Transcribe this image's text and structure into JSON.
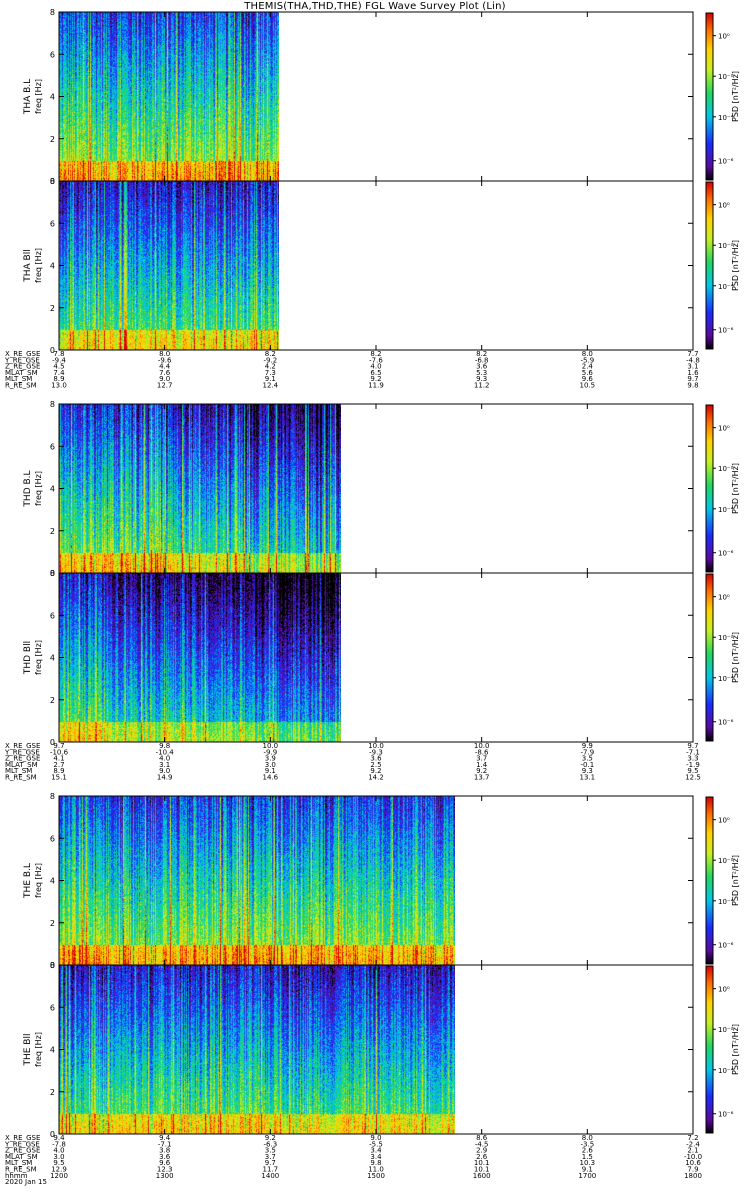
{
  "title": "THEMIS(THA,THD,THE) FGL Wave Survey Plot (Lin)",
  "colors": {
    "background": "#ffffff",
    "axes": "#000000"
  },
  "chart_data": {
    "type": "heatmap",
    "colormap": "rainbow (black-purple-blue-cyan-green-yellow-orange-red)",
    "x_axis": {
      "label": "hhmm",
      "ticks": [
        "1200",
        "1300",
        "1400",
        "1500",
        "1600",
        "1700",
        "1800"
      ]
    },
    "y_axis": {
      "range": [
        0,
        8
      ],
      "ticks": [
        "0",
        "2",
        "4",
        "6",
        "8"
      ]
    },
    "colorbar": {
      "scale": "log",
      "label": "PSD [nT²/Hz]",
      "ticks": [
        "10⁰",
        "10⁻²",
        "10⁻⁴",
        "10⁻⁶"
      ]
    },
    "probes": [
      {
        "panels": [
          {
            "name": "THA B.L",
            "ylabel": "freq [Hz]",
            "data_extent_hhmm": [
              "1200",
              "1405"
            ]
          },
          {
            "name": "THA Bll",
            "ylabel": "freq [Hz]",
            "data_extent_hhmm": [
              "1200",
              "1405"
            ]
          }
        ],
        "ephemeris": [
          {
            "label": "X_RE_GSE",
            "values": [
              "7.8",
              "8.0",
              "8.2",
              "8.2",
              "8.2",
              "8.0",
              "7.7"
            ]
          },
          {
            "label": "Y_RE_GSE",
            "values": [
              "-9.4",
              "-9.6",
              "-9.2",
              "-7.6",
              "-6.8",
              "-5.9",
              "-4.8"
            ]
          },
          {
            "label": "Z_RE_GSE",
            "values": [
              "4.5",
              "4.4",
              "4.2",
              "4.0",
              "3.6",
              "2.4",
              "3.1"
            ]
          },
          {
            "label": "MLAT_SM",
            "values": [
              "7.4",
              "7.6",
              "7.3",
              "6.5",
              "5.3",
              "5.6",
              "1.6"
            ]
          },
          {
            "label": "MLT_SM",
            "values": [
              "8.9",
              "9.0",
              "9.1",
              "9.2",
              "9.3",
              "9.6",
              "9.7"
            ]
          },
          {
            "label": "R_RE_SM",
            "values": [
              "13.0",
              "12.7",
              "12.4",
              "11.9",
              "11.2",
              "10.5",
              "9.8"
            ]
          }
        ]
      },
      {
        "panels": [
          {
            "name": "THD B.L",
            "ylabel": "freq [Hz]",
            "data_extent_hhmm": [
              "1200",
              "1440"
            ]
          },
          {
            "name": "THD Bll",
            "ylabel": "freq [Hz]",
            "data_extent_hhmm": [
              "1200",
              "1440"
            ]
          }
        ],
        "ephemeris": [
          {
            "label": "X_RE_GSE",
            "values": [
              "9.7",
              "9.8",
              "10.0",
              "10.0",
              "10.0",
              "9.9",
              "9.7"
            ]
          },
          {
            "label": "Y_RE_GSE",
            "values": [
              "-10.6",
              "-10.4",
              "-9.9",
              "-9.3",
              "-8.6",
              "-7.9",
              "-7.1"
            ]
          },
          {
            "label": "Z_RE_GSE",
            "values": [
              "4.1",
              "4.0",
              "3.9",
              "3.6",
              "3.7",
              "3.5",
              "3.3"
            ]
          },
          {
            "label": "MLAT_SM",
            "values": [
              "2.7",
              "3.1",
              "3.0",
              "2.5",
              "1.4",
              "-0.1",
              "-1.9"
            ]
          },
          {
            "label": "MLT_SM",
            "values": [
              "8.9",
              "9.0",
              "9.1",
              "9.2",
              "9.2",
              "9.3",
              "9.5"
            ]
          },
          {
            "label": "R_RE_SM",
            "values": [
              "15.1",
              "14.9",
              "14.6",
              "14.2",
              "13.7",
              "13.1",
              "12.5"
            ]
          }
        ]
      },
      {
        "panels": [
          {
            "name": "THE B.L",
            "ylabel": "freq [Hz]",
            "data_extent_hhmm": [
              "1200",
              "1545"
            ]
          },
          {
            "name": "THE Bll",
            "ylabel": "freq [Hz]",
            "data_extent_hhmm": [
              "1200",
              "1545"
            ]
          }
        ],
        "ephemeris": [
          {
            "label": "X_RE_GSE",
            "values": [
              "9.4",
              "9.4",
              "9.2",
              "9.0",
              "8.6",
              "8.0",
              "7.2"
            ]
          },
          {
            "label": "Y_RE_GSE",
            "values": [
              "-7.8",
              "-7.1",
              "-6.3",
              "-5.5",
              "-4.5",
              "-3.5",
              "-2.4"
            ]
          },
          {
            "label": "Z_RE_GSE",
            "values": [
              "4.0",
              "3.8",
              "3.5",
              "3.4",
              "2.9",
              "2.6",
              "2.1"
            ]
          },
          {
            "label": "MLAT_SM",
            "values": [
              "3.0",
              "3.6",
              "3.7",
              "3.4",
              "2.6",
              "1.5",
              "-10.0"
            ]
          },
          {
            "label": "MLT_SM",
            "values": [
              "9.5",
              "9.6",
              "9.7",
              "9.8",
              "10.1",
              "10.3",
              "10.6"
            ]
          },
          {
            "label": "R_RE_SM",
            "values": [
              "12.9",
              "12.3",
              "11.7",
              "11.0",
              "10.1",
              "9.1",
              "7.9"
            ]
          }
        ]
      }
    ],
    "time_row": {
      "label": "hhmm",
      "values": [
        "1200",
        "1300",
        "1400",
        "1500",
        "1600",
        "1700",
        "1800"
      ]
    },
    "date_label": "2020 Jan 15"
  }
}
